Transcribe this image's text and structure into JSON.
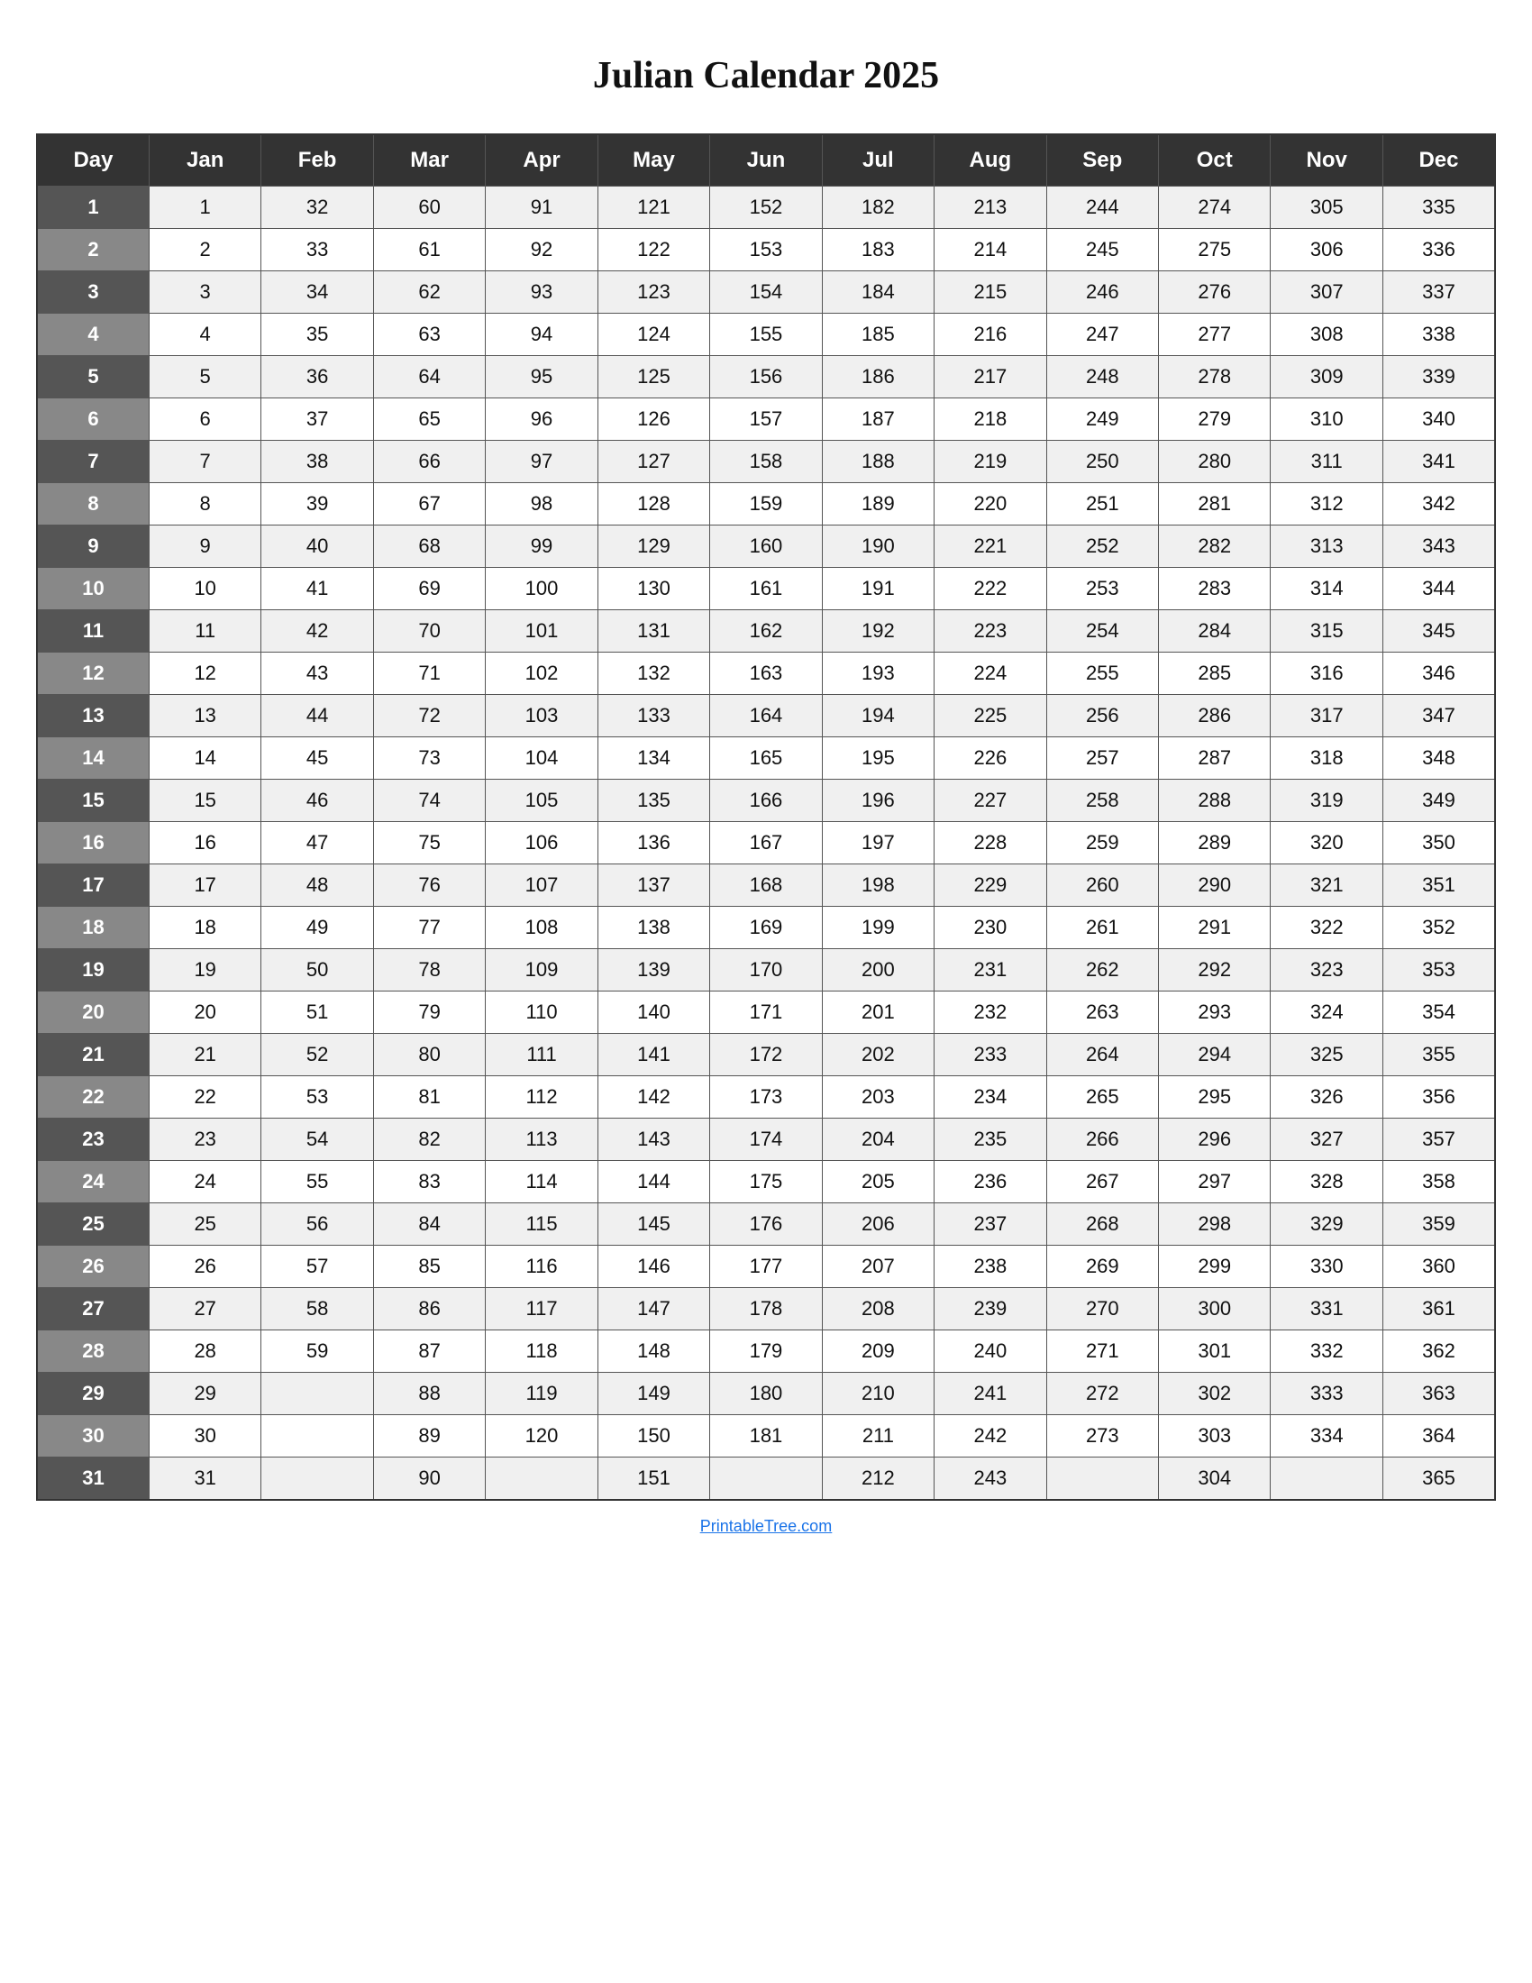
{
  "title": "Julian Calendar 2025",
  "headers": [
    "Day",
    "Jan",
    "Feb",
    "Mar",
    "Apr",
    "May",
    "Jun",
    "Jul",
    "Aug",
    "Sep",
    "Oct",
    "Nov",
    "Dec"
  ],
  "rows": [
    {
      "day": 1,
      "jan": 1,
      "feb": 32,
      "mar": 60,
      "apr": 91,
      "may": 121,
      "jun": 152,
      "jul": 182,
      "aug": 213,
      "sep": 244,
      "oct": 274,
      "nov": 305,
      "dec": 335
    },
    {
      "day": 2,
      "jan": 2,
      "feb": 33,
      "mar": 61,
      "apr": 92,
      "may": 122,
      "jun": 153,
      "jul": 183,
      "aug": 214,
      "sep": 245,
      "oct": 275,
      "nov": 306,
      "dec": 336
    },
    {
      "day": 3,
      "jan": 3,
      "feb": 34,
      "mar": 62,
      "apr": 93,
      "may": 123,
      "jun": 154,
      "jul": 184,
      "aug": 215,
      "sep": 246,
      "oct": 276,
      "nov": 307,
      "dec": 337
    },
    {
      "day": 4,
      "jan": 4,
      "feb": 35,
      "mar": 63,
      "apr": 94,
      "may": 124,
      "jun": 155,
      "jul": 185,
      "aug": 216,
      "sep": 247,
      "oct": 277,
      "nov": 308,
      "dec": 338
    },
    {
      "day": 5,
      "jan": 5,
      "feb": 36,
      "mar": 64,
      "apr": 95,
      "may": 125,
      "jun": 156,
      "jul": 186,
      "aug": 217,
      "sep": 248,
      "oct": 278,
      "nov": 309,
      "dec": 339
    },
    {
      "day": 6,
      "jan": 6,
      "feb": 37,
      "mar": 65,
      "apr": 96,
      "may": 126,
      "jun": 157,
      "jul": 187,
      "aug": 218,
      "sep": 249,
      "oct": 279,
      "nov": 310,
      "dec": 340
    },
    {
      "day": 7,
      "jan": 7,
      "feb": 38,
      "mar": 66,
      "apr": 97,
      "may": 127,
      "jun": 158,
      "jul": 188,
      "aug": 219,
      "sep": 250,
      "oct": 280,
      "nov": 311,
      "dec": 341
    },
    {
      "day": 8,
      "jan": 8,
      "feb": 39,
      "mar": 67,
      "apr": 98,
      "may": 128,
      "jun": 159,
      "jul": 189,
      "aug": 220,
      "sep": 251,
      "oct": 281,
      "nov": 312,
      "dec": 342
    },
    {
      "day": 9,
      "jan": 9,
      "feb": 40,
      "mar": 68,
      "apr": 99,
      "may": 129,
      "jun": 160,
      "jul": 190,
      "aug": 221,
      "sep": 252,
      "oct": 282,
      "nov": 313,
      "dec": 343
    },
    {
      "day": 10,
      "jan": 10,
      "feb": 41,
      "mar": 69,
      "apr": 100,
      "may": 130,
      "jun": 161,
      "jul": 191,
      "aug": 222,
      "sep": 253,
      "oct": 283,
      "nov": 314,
      "dec": 344
    },
    {
      "day": 11,
      "jan": 11,
      "feb": 42,
      "mar": 70,
      "apr": 101,
      "may": 131,
      "jun": 162,
      "jul": 192,
      "aug": 223,
      "sep": 254,
      "oct": 284,
      "nov": 315,
      "dec": 345
    },
    {
      "day": 12,
      "jan": 12,
      "feb": 43,
      "mar": 71,
      "apr": 102,
      "may": 132,
      "jun": 163,
      "jul": 193,
      "aug": 224,
      "sep": 255,
      "oct": 285,
      "nov": 316,
      "dec": 346
    },
    {
      "day": 13,
      "jan": 13,
      "feb": 44,
      "mar": 72,
      "apr": 103,
      "may": 133,
      "jun": 164,
      "jul": 194,
      "aug": 225,
      "sep": 256,
      "oct": 286,
      "nov": 317,
      "dec": 347
    },
    {
      "day": 14,
      "jan": 14,
      "feb": 45,
      "mar": 73,
      "apr": 104,
      "may": 134,
      "jun": 165,
      "jul": 195,
      "aug": 226,
      "sep": 257,
      "oct": 287,
      "nov": 318,
      "dec": 348
    },
    {
      "day": 15,
      "jan": 15,
      "feb": 46,
      "mar": 74,
      "apr": 105,
      "may": 135,
      "jun": 166,
      "jul": 196,
      "aug": 227,
      "sep": 258,
      "oct": 288,
      "nov": 319,
      "dec": 349
    },
    {
      "day": 16,
      "jan": 16,
      "feb": 47,
      "mar": 75,
      "apr": 106,
      "may": 136,
      "jun": 167,
      "jul": 197,
      "aug": 228,
      "sep": 259,
      "oct": 289,
      "nov": 320,
      "dec": 350
    },
    {
      "day": 17,
      "jan": 17,
      "feb": 48,
      "mar": 76,
      "apr": 107,
      "may": 137,
      "jun": 168,
      "jul": 198,
      "aug": 229,
      "sep": 260,
      "oct": 290,
      "nov": 321,
      "dec": 351
    },
    {
      "day": 18,
      "jan": 18,
      "feb": 49,
      "mar": 77,
      "apr": 108,
      "may": 138,
      "jun": 169,
      "jul": 199,
      "aug": 230,
      "sep": 261,
      "oct": 291,
      "nov": 322,
      "dec": 352
    },
    {
      "day": 19,
      "jan": 19,
      "feb": 50,
      "mar": 78,
      "apr": 109,
      "may": 139,
      "jun": 170,
      "jul": 200,
      "aug": 231,
      "sep": 262,
      "oct": 292,
      "nov": 323,
      "dec": 353
    },
    {
      "day": 20,
      "jan": 20,
      "feb": 51,
      "mar": 79,
      "apr": 110,
      "may": 140,
      "jun": 171,
      "jul": 201,
      "aug": 232,
      "sep": 263,
      "oct": 293,
      "nov": 324,
      "dec": 354
    },
    {
      "day": 21,
      "jan": 21,
      "feb": 52,
      "mar": 80,
      "apr": 111,
      "may": 141,
      "jun": 172,
      "jul": 202,
      "aug": 233,
      "sep": 264,
      "oct": 294,
      "nov": 325,
      "dec": 355
    },
    {
      "day": 22,
      "jan": 22,
      "feb": 53,
      "mar": 81,
      "apr": 112,
      "may": 142,
      "jun": 173,
      "jul": 203,
      "aug": 234,
      "sep": 265,
      "oct": 295,
      "nov": 326,
      "dec": 356
    },
    {
      "day": 23,
      "jan": 23,
      "feb": 54,
      "mar": 82,
      "apr": 113,
      "may": 143,
      "jun": 174,
      "jul": 204,
      "aug": 235,
      "sep": 266,
      "oct": 296,
      "nov": 327,
      "dec": 357
    },
    {
      "day": 24,
      "jan": 24,
      "feb": 55,
      "mar": 83,
      "apr": 114,
      "may": 144,
      "jun": 175,
      "jul": 205,
      "aug": 236,
      "sep": 267,
      "oct": 297,
      "nov": 328,
      "dec": 358
    },
    {
      "day": 25,
      "jan": 25,
      "feb": 56,
      "mar": 84,
      "apr": 115,
      "may": 145,
      "jun": 176,
      "jul": 206,
      "aug": 237,
      "sep": 268,
      "oct": 298,
      "nov": 329,
      "dec": 359
    },
    {
      "day": 26,
      "jan": 26,
      "feb": 57,
      "mar": 85,
      "apr": 116,
      "may": 146,
      "jun": 177,
      "jul": 207,
      "aug": 238,
      "sep": 269,
      "oct": 299,
      "nov": 330,
      "dec": 360
    },
    {
      "day": 27,
      "jan": 27,
      "feb": 58,
      "mar": 86,
      "apr": 117,
      "may": 147,
      "jun": 178,
      "jul": 208,
      "aug": 239,
      "sep": 270,
      "oct": 300,
      "nov": 331,
      "dec": 361
    },
    {
      "day": 28,
      "jan": 28,
      "feb": 59,
      "mar": 87,
      "apr": 118,
      "may": 148,
      "jun": 179,
      "jul": 209,
      "aug": 240,
      "sep": 271,
      "oct": 301,
      "nov": 332,
      "dec": 362
    },
    {
      "day": 29,
      "jan": 29,
      "feb": null,
      "mar": 88,
      "apr": 119,
      "may": 149,
      "jun": 180,
      "jul": 210,
      "aug": 241,
      "sep": 272,
      "oct": 302,
      "nov": 333,
      "dec": 363
    },
    {
      "day": 30,
      "jan": 30,
      "feb": null,
      "mar": 89,
      "apr": 120,
      "may": 150,
      "jun": 181,
      "jul": 211,
      "aug": 242,
      "sep": 273,
      "oct": 303,
      "nov": 334,
      "dec": 364
    },
    {
      "day": 31,
      "jan": 31,
      "feb": null,
      "mar": 90,
      "apr": null,
      "may": 151,
      "jun": null,
      "jul": 212,
      "aug": 243,
      "sep": null,
      "oct": 304,
      "nov": null,
      "dec": 365
    }
  ],
  "footer_link": "PrintableTree.com",
  "footer_url": "#"
}
